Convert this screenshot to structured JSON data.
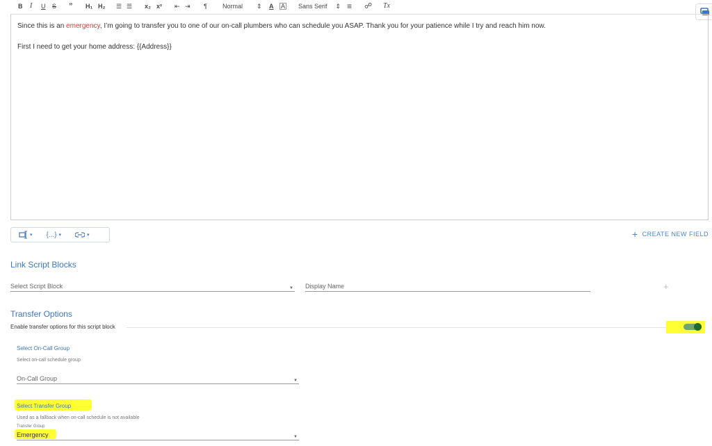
{
  "toolbar": {
    "bold": "B",
    "italic": "I",
    "underline": "U",
    "strike": "S",
    "quote": "”",
    "h1": "H₁",
    "h2": "H₂",
    "ordered_list": "☰",
    "bullet_list": "☰",
    "subscript": "x₂",
    "superscript": "x²",
    "indent_out": "⇤",
    "indent_in": "⇥",
    "direction": "¶",
    "size_select": "Normal",
    "font_select": "Sans Serif",
    "text_color": "A",
    "bg_color": "A",
    "align": "≡",
    "link": "☍",
    "clear": "Tx"
  },
  "editor": {
    "line1_before": "Since this is an ",
    "line1_emphasis": "emergency",
    "line1_after": ", I’m going to transfer you to one of our on-call plumbers who can schedule you ASAP. Thank you for your patience while I try and reach him now.",
    "line2": "First I need to get your home address: {{Address}}",
    "emphasis_color": "#e53935"
  },
  "field_bar": {
    "insert_field_caret": "▾",
    "variable_label": "{...}",
    "variable_caret": "▾",
    "link_caret": "▾"
  },
  "create_field": {
    "icon": "+",
    "label": "CREATE NEW FIELD"
  },
  "link_script": {
    "title": "Link Script Blocks",
    "select_placeholder": "Select Script Block",
    "display_name_placeholder": "Display Name",
    "add_icon": "+"
  },
  "transfer": {
    "title": "Transfer Options",
    "enable_label": "Enable transfer options for this script block",
    "enabled": true,
    "oncall_title": "Select On-Call Group",
    "oncall_help": "Select on-call schedule group",
    "oncall_value": "On-Call Group",
    "transfer_title": "Select Transfer Group",
    "transfer_help": "Used as a fallback when on-call schedule is not available",
    "transfer_field_label": "Transfer Group",
    "transfer_value": "Emergency"
  },
  "colors": {
    "accent": "#3a78bf",
    "highlight": "#ffff33",
    "toggle_on": "#1b6e2e"
  }
}
